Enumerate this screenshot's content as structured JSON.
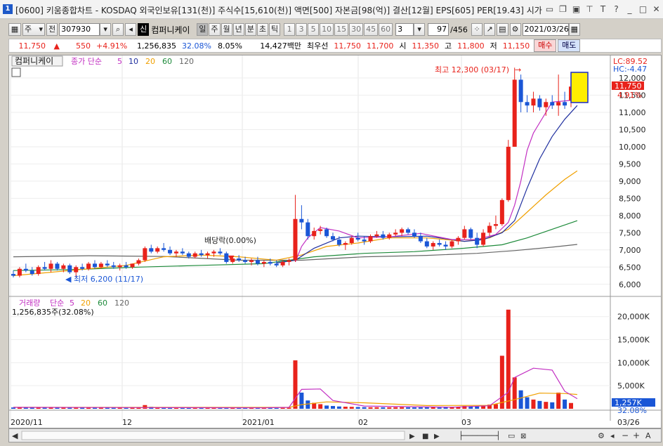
{
  "title": "[0600] 키움종합차트 - KOSDAQ 외국인보유[131(천)] 주식수[15,610(천)] 액면[500] 자본금[98(억)] 결산[12월] EPS[605] PER[19.43] 시가",
  "window_number": "1",
  "toolbar": {
    "period_select": "주",
    "prev_label": "전",
    "code": "307930",
    "stock_name": "컴퍼니케이",
    "name_badge": "신",
    "period_buttons": [
      "일",
      "주",
      "월",
      "년",
      "분",
      "초",
      "틱"
    ],
    "minute_buttons": [
      "1",
      "3",
      "5",
      "10",
      "15",
      "30",
      "45",
      "60"
    ],
    "n_value": "3",
    "page_counter": "97",
    "page_total": "/456",
    "date": "2021/03/26"
  },
  "quote": {
    "price": "11,750",
    "change": "550",
    "change_pct": "+4.91%",
    "volume": "1,256,835",
    "volume_ratio": "32.08%",
    "turnover": "8.05%",
    "amount": "14,427백만",
    "best_label": "최우선",
    "ask": "11,750",
    "bid": "11,700",
    "open_label": "시",
    "open": "11,350",
    "high_label": "고",
    "high": "11,800",
    "low_label": "저",
    "low": "11,150",
    "buy_label": "매수",
    "sell_label": "매도"
  },
  "price_legend": {
    "name": "컴퍼니케이",
    "ma_label": "종가 단순",
    "ma_periods": [
      "5",
      "10",
      "20",
      "60",
      "120"
    ]
  },
  "volume_legend": {
    "label": "거래량",
    "ma_label": "단순",
    "ma_periods": [
      "5",
      "20",
      "60",
      "120"
    ],
    "current": "1,256,835주(32.08%)"
  },
  "annotations": {
    "high": "최고 12,300 (03/17)",
    "low": "최저 6,200 (11/17)",
    "dividend": "배당락(0.00%)"
  },
  "right_labels": {
    "lc": "LC:89.52",
    "hc": "HC:-4.47",
    "last_price": "11,750",
    "last_pct": "4.91%",
    "vol_last": "1,257K",
    "vol_pct": "32.08%"
  },
  "x_axis": {
    "labels": [
      "2020/11",
      "12",
      "2021/01",
      "02",
      "03"
    ],
    "right_date": "03/26"
  },
  "colors": {
    "up": "#e8221b",
    "down": "#1a56d6",
    "ma5": "#c22fc2",
    "ma10": "#1f2f9f",
    "ma20": "#f0a000",
    "ma60": "#1d8a3a",
    "ma120": "#666666"
  },
  "chart_data": {
    "type": "candlestick",
    "y_ticks": [
      6000,
      6500,
      7000,
      7500,
      8000,
      8500,
      9000,
      9500,
      10000,
      10500,
      11000,
      11500,
      12000
    ],
    "vol_ticks": [
      "5,000K",
      "10,000K",
      "15,000K",
      "20,000K"
    ],
    "candles": [
      [
        6300,
        6400,
        6200,
        6250,
        280
      ],
      [
        6250,
        6500,
        6200,
        6450,
        350
      ],
      [
        6450,
        6600,
        6350,
        6400,
        300
      ],
      [
        6400,
        6500,
        6250,
        6300,
        260
      ],
      [
        6300,
        6550,
        6250,
        6500,
        320
      ],
      [
        6500,
        6650,
        6400,
        6450,
        300
      ],
      [
        6450,
        6700,
        6350,
        6600,
        380
      ],
      [
        6600,
        6650,
        6400,
        6450,
        290
      ],
      [
        6450,
        6600,
        6350,
        6550,
        270
      ],
      [
        6550,
        6600,
        6300,
        6350,
        260
      ],
      [
        6350,
        6550,
        6200,
        6500,
        300
      ],
      [
        6500,
        6600,
        6400,
        6450,
        250
      ],
      [
        6450,
        6650,
        6400,
        6600,
        280
      ],
      [
        6600,
        6700,
        6450,
        6500,
        260
      ],
      [
        6500,
        6650,
        6450,
        6600,
        240
      ],
      [
        6600,
        6700,
        6500,
        6550,
        230
      ],
      [
        6550,
        6650,
        6450,
        6500,
        220
      ],
      [
        6500,
        6600,
        6400,
        6550,
        230
      ],
      [
        6550,
        6650,
        6450,
        6500,
        210
      ],
      [
        6500,
        6600,
        6450,
        6600,
        240
      ],
      [
        6600,
        6750,
        6550,
        6700,
        260
      ],
      [
        6700,
        7100,
        6650,
        7050,
        800
      ],
      [
        7050,
        7150,
        6900,
        6950,
        420
      ],
      [
        6950,
        7100,
        6900,
        7050,
        350
      ],
      [
        7050,
        7200,
        6950,
        7000,
        330
      ],
      [
        7000,
        7100,
        6850,
        6900,
        300
      ],
      [
        6900,
        7000,
        6800,
        6950,
        270
      ],
      [
        6950,
        7050,
        6850,
        6900,
        250
      ],
      [
        6900,
        6950,
        6750,
        6800,
        240
      ],
      [
        6800,
        6950,
        6750,
        6900,
        230
      ],
      [
        6900,
        7000,
        6800,
        6850,
        210
      ],
      [
        6850,
        6950,
        6750,
        6900,
        220
      ],
      [
        6900,
        7000,
        6800,
        6950,
        230
      ],
      [
        6950,
        7050,
        6850,
        6900,
        220
      ],
      [
        6900,
        6950,
        6600,
        6650,
        350
      ],
      [
        6650,
        6800,
        6600,
        6750,
        260
      ],
      [
        6750,
        6850,
        6650,
        6700,
        230
      ],
      [
        6700,
        6800,
        6600,
        6650,
        220
      ],
      [
        6650,
        6750,
        6550,
        6700,
        210
      ],
      [
        6700,
        6800,
        6550,
        6600,
        220
      ],
      [
        6600,
        6700,
        6500,
        6650,
        210
      ],
      [
        6650,
        6750,
        6550,
        6600,
        200
      ],
      [
        6600,
        6700,
        6500,
        6550,
        200
      ],
      [
        6550,
        6700,
        6500,
        6650,
        210
      ],
      [
        6650,
        6750,
        6550,
        6700,
        220
      ],
      [
        6700,
        8600,
        6650,
        7900,
        10500
      ],
      [
        7900,
        8300,
        7600,
        7800,
        3500
      ],
      [
        7800,
        7900,
        7300,
        7400,
        1800
      ],
      [
        7400,
        7650,
        7300,
        7550,
        1300
      ],
      [
        7550,
        7700,
        7450,
        7600,
        1000
      ],
      [
        7600,
        7650,
        7350,
        7400,
        700
      ],
      [
        7400,
        7500,
        7250,
        7300,
        600
      ],
      [
        7300,
        7400,
        7100,
        7150,
        500
      ],
      [
        7150,
        7250,
        7000,
        7200,
        450
      ],
      [
        7200,
        7400,
        7150,
        7350,
        420
      ],
      [
        7350,
        7500,
        7250,
        7300,
        380
      ],
      [
        7300,
        7400,
        7150,
        7250,
        350
      ],
      [
        7250,
        7450,
        7200,
        7400,
        330
      ],
      [
        7400,
        7550,
        7350,
        7450,
        340
      ],
      [
        7450,
        7550,
        7300,
        7350,
        320
      ],
      [
        7350,
        7500,
        7300,
        7450,
        310
      ],
      [
        7450,
        7600,
        7400,
        7500,
        330
      ],
      [
        7500,
        7650,
        7400,
        7600,
        350
      ],
      [
        7600,
        7650,
        7450,
        7500,
        320
      ],
      [
        7500,
        7600,
        7350,
        7400,
        300
      ],
      [
        7400,
        7500,
        7200,
        7250,
        310
      ],
      [
        7250,
        7350,
        7050,
        7100,
        300
      ],
      [
        7100,
        7250,
        7000,
        7200,
        320
      ],
      [
        7200,
        7300,
        7100,
        7150,
        280
      ],
      [
        7150,
        7250,
        7000,
        7100,
        300
      ],
      [
        7100,
        7300,
        7050,
        7250,
        330
      ],
      [
        7250,
        7400,
        7150,
        7350,
        400
      ],
      [
        7350,
        7700,
        7300,
        7600,
        600
      ],
      [
        7600,
        7650,
        7300,
        7350,
        550
      ],
      [
        7350,
        7500,
        7050,
        7150,
        500
      ],
      [
        7150,
        7600,
        7100,
        7500,
        700
      ],
      [
        7500,
        7800,
        7400,
        7700,
        900
      ],
      [
        7700,
        8000,
        7600,
        7750,
        1000
      ],
      [
        7750,
        8500,
        7700,
        8450,
        11500
      ],
      [
        8450,
        10200,
        8400,
        10000,
        21500
      ],
      [
        10000,
        12300,
        10000,
        11950,
        6800
      ],
      [
        11950,
        12100,
        11000,
        11300,
        4000
      ],
      [
        11300,
        11500,
        11000,
        11200,
        2500
      ],
      [
        11200,
        11600,
        11000,
        11400,
        2000
      ],
      [
        11400,
        11500,
        11050,
        11150,
        1700
      ],
      [
        11150,
        11400,
        10900,
        11300,
        1500
      ],
      [
        11300,
        11500,
        11100,
        11200,
        1400
      ],
      [
        11200,
        12100,
        10900,
        11300,
        3500
      ],
      [
        11300,
        11600,
        11100,
        11200,
        2000
      ],
      [
        11350,
        11800,
        11150,
        11750,
        1257
      ]
    ],
    "ma": {
      "ma5": [
        [
          45,
          6650
        ],
        [
          46,
          7100
        ],
        [
          47,
          7350
        ],
        [
          48,
          7500
        ],
        [
          49,
          7650
        ],
        [
          52,
          7550
        ],
        [
          55,
          7350
        ],
        [
          60,
          7380
        ],
        [
          65,
          7480
        ],
        [
          70,
          7300
        ],
        [
          74,
          7300
        ],
        [
          77,
          7450
        ],
        [
          79,
          7800
        ],
        [
          80,
          8300
        ],
        [
          81,
          9000
        ],
        [
          82,
          9900
        ],
        [
          83,
          10400
        ],
        [
          86,
          11300
        ],
        [
          89,
          11350
        ],
        [
          90,
          11400
        ]
      ],
      "ma10": [
        [
          42,
          6620
        ],
        [
          45,
          6700
        ],
        [
          48,
          7050
        ],
        [
          52,
          7350
        ],
        [
          55,
          7400
        ],
        [
          60,
          7380
        ],
        [
          66,
          7400
        ],
        [
          72,
          7250
        ],
        [
          75,
          7300
        ],
        [
          78,
          7500
        ],
        [
          80,
          7850
        ],
        [
          82,
          8800
        ],
        [
          84,
          9650
        ],
        [
          86,
          10300
        ],
        [
          88,
          10800
        ],
        [
          90,
          11200
        ]
      ],
      "ma20": [
        [
          0,
          6250
        ],
        [
          6,
          6350
        ],
        [
          12,
          6450
        ],
        [
          18,
          6550
        ],
        [
          24,
          6800
        ],
        [
          30,
          6850
        ],
        [
          36,
          6800
        ],
        [
          42,
          6700
        ],
        [
          46,
          6850
        ],
        [
          50,
          7100
        ],
        [
          55,
          7200
        ],
        [
          60,
          7350
        ],
        [
          66,
          7350
        ],
        [
          72,
          7250
        ],
        [
          76,
          7350
        ],
        [
          79,
          7600
        ],
        [
          82,
          8100
        ],
        [
          85,
          8600
        ],
        [
          88,
          9050
        ],
        [
          90,
          9300
        ]
      ],
      "ma60": [
        [
          0,
          6400
        ],
        [
          10,
          6430
        ],
        [
          20,
          6500
        ],
        [
          30,
          6550
        ],
        [
          40,
          6600
        ],
        [
          48,
          6800
        ],
        [
          56,
          6900
        ],
        [
          64,
          6950
        ],
        [
          72,
          7050
        ],
        [
          78,
          7150
        ],
        [
          82,
          7350
        ],
        [
          86,
          7600
        ],
        [
          90,
          7850
        ]
      ],
      "ma120": [
        [
          0,
          6800
        ],
        [
          12,
          6830
        ],
        [
          24,
          6810
        ],
        [
          36,
          6700
        ],
        [
          46,
          6700
        ],
        [
          56,
          6800
        ],
        [
          66,
          6840
        ],
        [
          74,
          6900
        ],
        [
          80,
          6980
        ],
        [
          86,
          7080
        ],
        [
          90,
          7160
        ]
      ],
      "vol_ma5": [
        [
          0,
          300
        ],
        [
          20,
          260
        ],
        [
          40,
          220
        ],
        [
          44,
          300
        ],
        [
          46,
          4200
        ],
        [
          49,
          4300
        ],
        [
          51,
          1800
        ],
        [
          56,
          600
        ],
        [
          70,
          350
        ],
        [
          76,
          650
        ],
        [
          79,
          3600
        ],
        [
          80,
          6800
        ],
        [
          83,
          8800
        ],
        [
          86,
          8400
        ],
        [
          88,
          3800
        ],
        [
          90,
          2200
        ]
      ],
      "vol_ma20": [
        [
          0,
          320
        ],
        [
          44,
          300
        ],
        [
          46,
          900
        ],
        [
          50,
          1500
        ],
        [
          56,
          1300
        ],
        [
          66,
          700
        ],
        [
          76,
          750
        ],
        [
          80,
          2000
        ],
        [
          84,
          3400
        ],
        [
          88,
          3300
        ],
        [
          90,
          3100
        ]
      ]
    }
  }
}
